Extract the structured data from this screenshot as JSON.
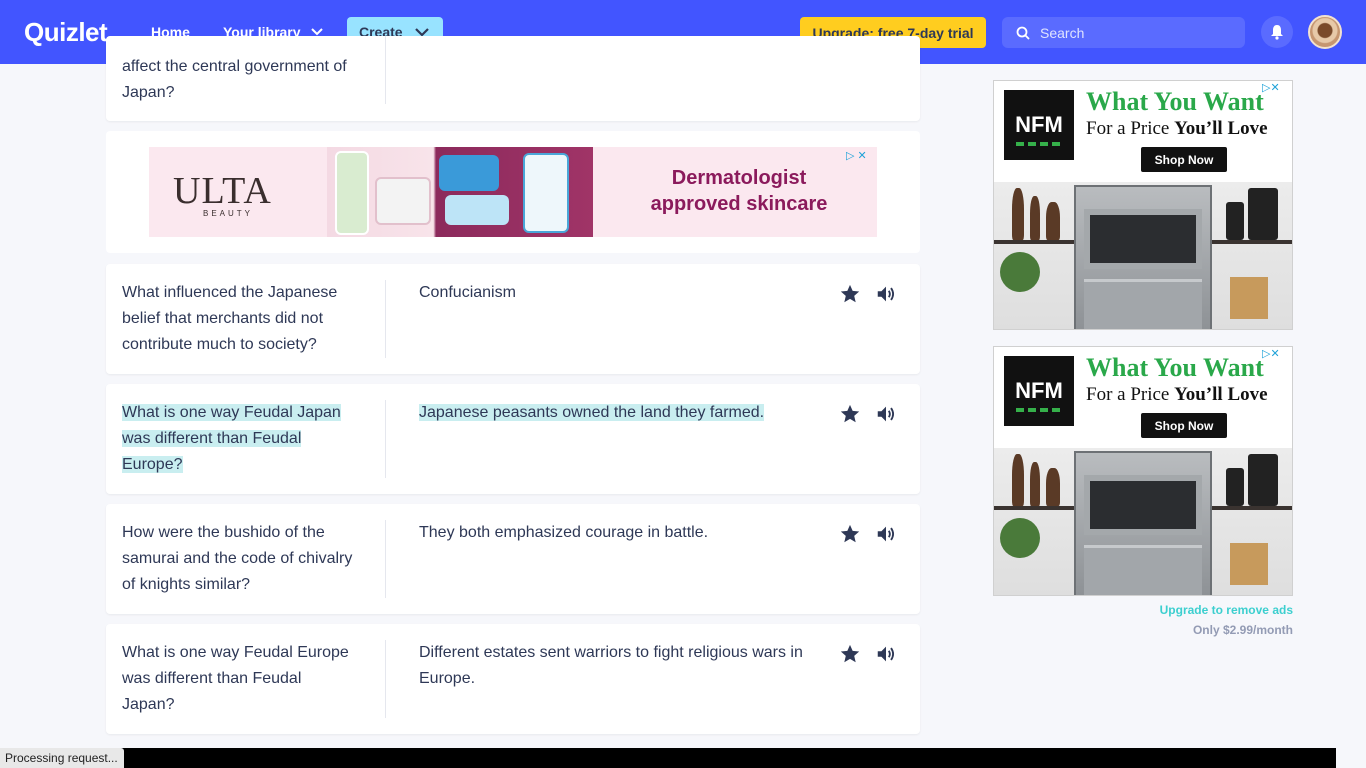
{
  "header": {
    "logo": "Quizlet",
    "nav_home": "Home",
    "nav_library": "Your library",
    "create_label": "Create",
    "upgrade_label": "Upgrade: free 7-day trial",
    "search_placeholder": "Search"
  },
  "cards": [
    {
      "term": "affect the central government of Japan?",
      "definition": ""
    },
    {
      "term": "What influenced the Japanese belief that merchants did not contribute much to society?",
      "definition": "Confucianism"
    },
    {
      "term": "What is one way Feudal Japan was different than Feudal Europe?",
      "definition": "Japanese peasants owned the land they farmed.",
      "highlighted": true
    },
    {
      "term": "How were the bushido of the samurai and the code of chivalry of knights similar?",
      "definition": "They both emphasized courage in battle."
    },
    {
      "term": "What is one way Feudal Europe was different than Feudal Japan?",
      "definition": "Different estates sent warriors to fight religious wars in Europe."
    }
  ],
  "ads": {
    "ulta": {
      "brand": "ULTA",
      "brand_sub": "BEAUTY",
      "headline_line1": "Dermatologist",
      "headline_line2": "approved skincare"
    },
    "nfm": {
      "logo": "NFM",
      "headline": "What You Want",
      "sub_prefix": "For a Price ",
      "sub_bold": "You’ll Love",
      "button": "Shop Now"
    }
  },
  "sidebar": {
    "remove_ads": "Upgrade to remove ads",
    "price": "Only $2.99/month"
  },
  "status": {
    "text": "Processing request..."
  },
  "colors": {
    "brand_header": "#4255ff",
    "create_button": "#98e3ff",
    "upgrade_button": "#ffcd1f",
    "highlight": "#c9eef0",
    "text": "#2e3856"
  }
}
